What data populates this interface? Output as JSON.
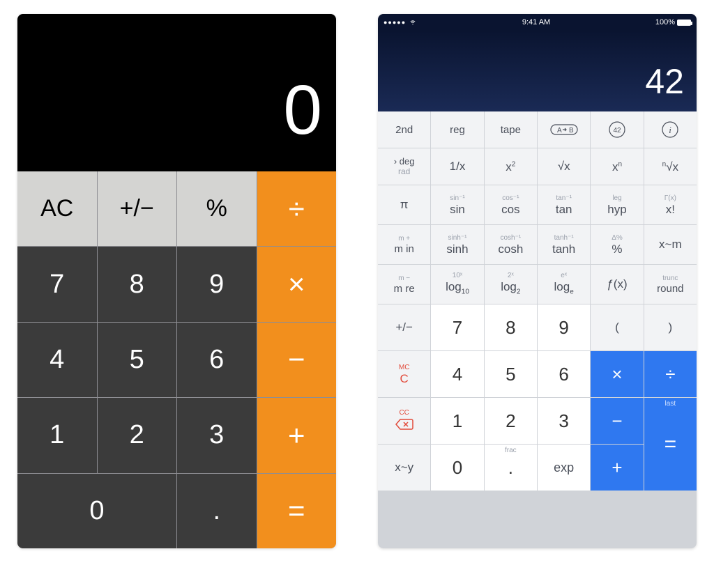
{
  "calc1": {
    "display": "0",
    "keys": {
      "ac": "AC",
      "sign": "+/−",
      "pct": "%",
      "div": "÷",
      "k7": "7",
      "k8": "8",
      "k9": "9",
      "mul": "×",
      "k4": "4",
      "k5": "5",
      "k6": "6",
      "sub": "−",
      "k1": "1",
      "k2": "2",
      "k3": "3",
      "add": "+",
      "k0": "0",
      "dot": ".",
      "eq": "="
    }
  },
  "calc2": {
    "status": {
      "dots": "●●●●●",
      "time": "9:41 AM",
      "battery": "100%"
    },
    "display": "42",
    "row1": {
      "second": "2nd",
      "reg": "reg",
      "tape": "tape",
      "ab": "A › B",
      "forty2": "42",
      "info": "i"
    },
    "row2": {
      "deg_main": "› deg",
      "deg_sub": "rad",
      "inv": "1/x",
      "sq": "x",
      "sq_sup": "2",
      "sqrt": "√x",
      "xn": "x",
      "xn_sup": "n",
      "nroot_sup": "n",
      "nroot": "√x"
    },
    "row3": {
      "pi": "π",
      "sin_sup": "sin⁻¹",
      "sin": "sin",
      "cos_sup": "cos⁻¹",
      "cos": "cos",
      "tan_sup": "tan⁻¹",
      "tan": "tan",
      "hyp_sup": "leg",
      "hyp": "hyp",
      "fact_sup": "Γ(x)",
      "fact": "x!"
    },
    "row4": {
      "min_sup": "m +",
      "min": "m in",
      "sinh_sup": "sinh⁻¹",
      "sinh": "sinh",
      "cosh_sup": "cosh⁻¹",
      "cosh": "cosh",
      "tanh_sup": "tanh⁻¹",
      "tanh": "tanh",
      "pct_sup": "Δ%",
      "pct": "%",
      "xm": "x~m"
    },
    "row5": {
      "mre_sup": "m −",
      "mre": "m re",
      "log10_sup": "10ˣ",
      "log10": "log",
      "log10_sub": "10",
      "log2_sup": "2ˣ",
      "log2": "log",
      "log2_sub": "2",
      "loge_sup": "eˣ",
      "loge": "log",
      "loge_sub": "e",
      "fx": "ƒ(x)",
      "round_sup": "trunc",
      "round": "round"
    },
    "row6": {
      "sign": "+/−",
      "k7": "7",
      "k8": "8",
      "k9": "9",
      "lp": "(",
      "rp": ")"
    },
    "row7": {
      "c_sup": "MC",
      "c": "C",
      "k4": "4",
      "k5": "5",
      "k6": "6",
      "mul": "×",
      "div": "÷"
    },
    "row8": {
      "del_sup": "CC",
      "k1": "1",
      "k2": "2",
      "k3": "3",
      "sub": "−",
      "last_sup": "last",
      "eq": "="
    },
    "row9": {
      "xy": "x~y",
      "k0": "0",
      "dot_sup": "frac",
      "dot": ".",
      "exp": "exp",
      "add": "+"
    }
  }
}
